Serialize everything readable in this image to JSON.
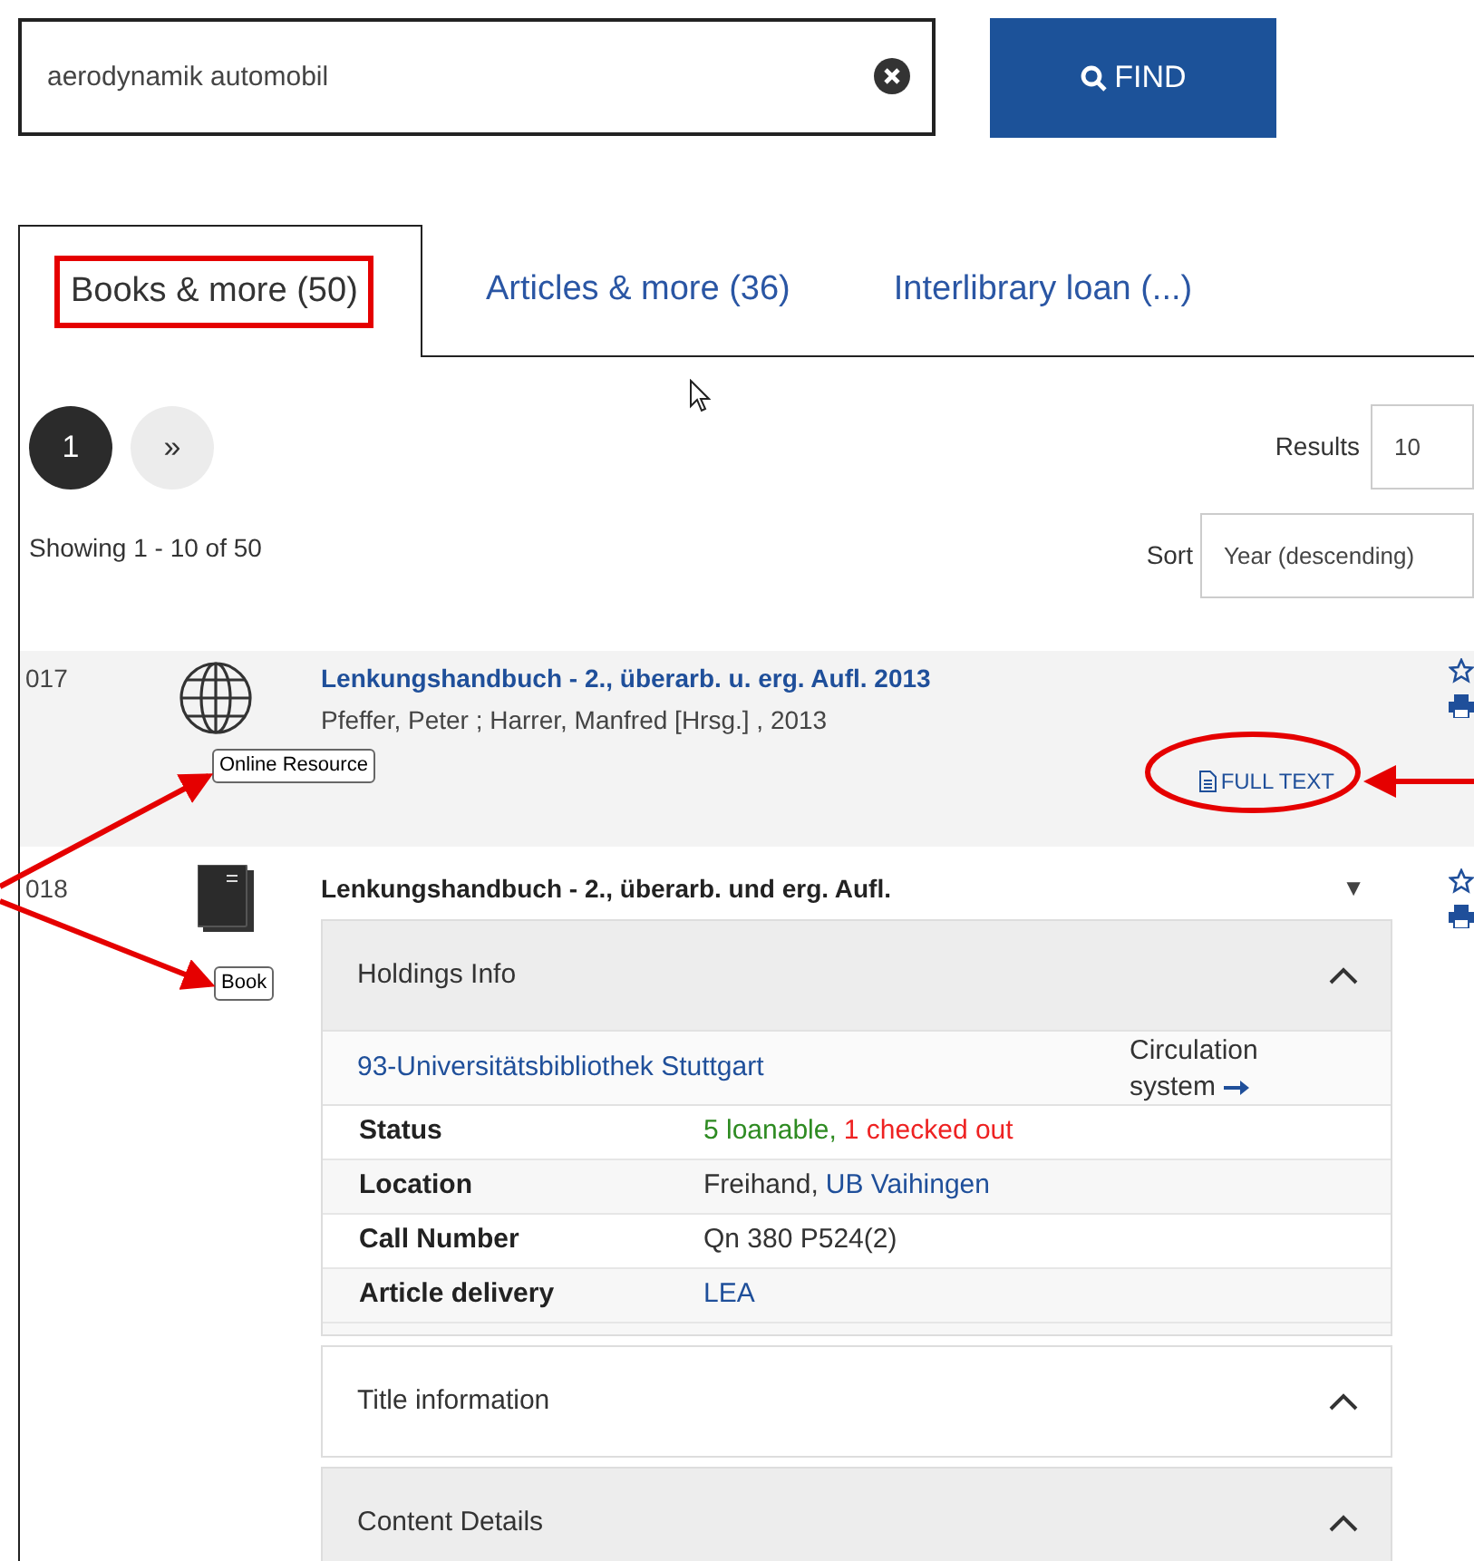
{
  "search": {
    "value": "aerodynamik automobil"
  },
  "find_button": {
    "label": "FIND"
  },
  "tabs": [
    {
      "label": "Books & more (50)",
      "selected": true,
      "annotated": true
    },
    {
      "label": "Articles & more (36)",
      "selected": false,
      "annotated": false
    },
    {
      "label": "Interlibrary loan (...)",
      "selected": false,
      "annotated": false
    }
  ],
  "pagination": [
    {
      "label": "1",
      "selected": true
    },
    {
      "label": "»",
      "selected": false
    }
  ],
  "results_per_page": {
    "label": "Results",
    "value": "10"
  },
  "showing": "Showing 1 - 10 of 50",
  "sort": {
    "label": "Sort",
    "value": "Year (descending)"
  },
  "results": [
    {
      "number": "017",
      "kind": "online",
      "format": "Online Resource",
      "format_annotated": true,
      "title": "Lenkungshandbuch - 2., überarb. u. erg. Aufl. 2013",
      "title_link": true,
      "authors": "Pfeffer, Peter ; Harrer, Manfred [Hrsg.] , 2013",
      "full_text": {
        "label": "FULL TEXT",
        "annotated": true
      },
      "shaded": true
    },
    {
      "number": "018",
      "kind": "book",
      "format": "Book",
      "format_annotated": true,
      "title": "Lenkungshandbuch - 2., überarb. und erg. Aufl.",
      "title_link": false,
      "toggle": "▼",
      "shaded": false,
      "panels": [
        {
          "title": "Holdings Info",
          "shaded": true,
          "expanded": true,
          "library": "93-Universitätsbibliothek Stuttgart",
          "circulation": "Circulation system",
          "rows": [
            {
              "label": "Status",
              "value": [
                {
                  "text": "5 loanable,",
                  "kind": "ok"
                },
                {
                  "text": "1 checked out",
                  "kind": "warn"
                }
              ]
            },
            {
              "label": "Location",
              "value": [
                {
                  "text": "Freihand,",
                  "kind": "plain"
                },
                {
                  "text": "UB Vaihingen",
                  "kind": "link"
                }
              ]
            },
            {
              "label": "Call Number",
              "value": [
                {
                  "text": "Qn 380 P524(2)",
                  "kind": "plain"
                }
              ]
            },
            {
              "label": "Article delivery",
              "value": [
                {
                  "text": "LEA",
                  "kind": "link"
                }
              ]
            }
          ]
        },
        {
          "title": "Title information",
          "shaded": false,
          "expanded": false
        },
        {
          "title": "Content Details",
          "shaded": true,
          "expanded": false
        }
      ]
    }
  ]
}
